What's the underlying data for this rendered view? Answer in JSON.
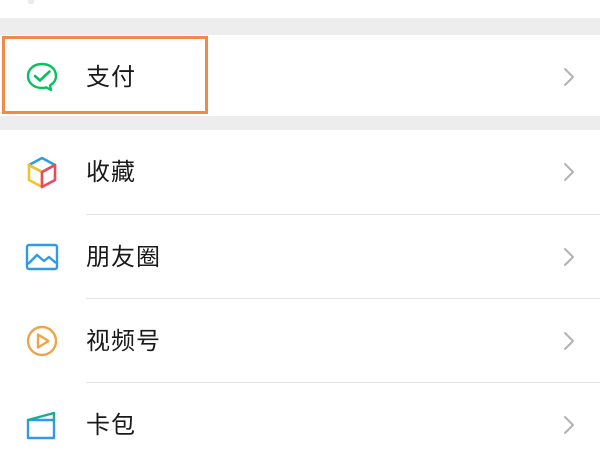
{
  "menu": {
    "pay": {
      "label": "支付",
      "icon": "wechat-pay-icon"
    },
    "items": [
      {
        "label": "收藏",
        "icon": "favorites-cube-icon"
      },
      {
        "label": "朋友圈",
        "icon": "moments-photo-icon"
      },
      {
        "label": "视频号",
        "icon": "channels-play-icon"
      },
      {
        "label": "卡包",
        "icon": "card-wallet-icon"
      }
    ]
  },
  "colors": {
    "pay_green": "#07c160",
    "highlight_border": "#f08a4b",
    "separator_gray": "#ededed",
    "chevron_gray": "#b2b2b2"
  }
}
